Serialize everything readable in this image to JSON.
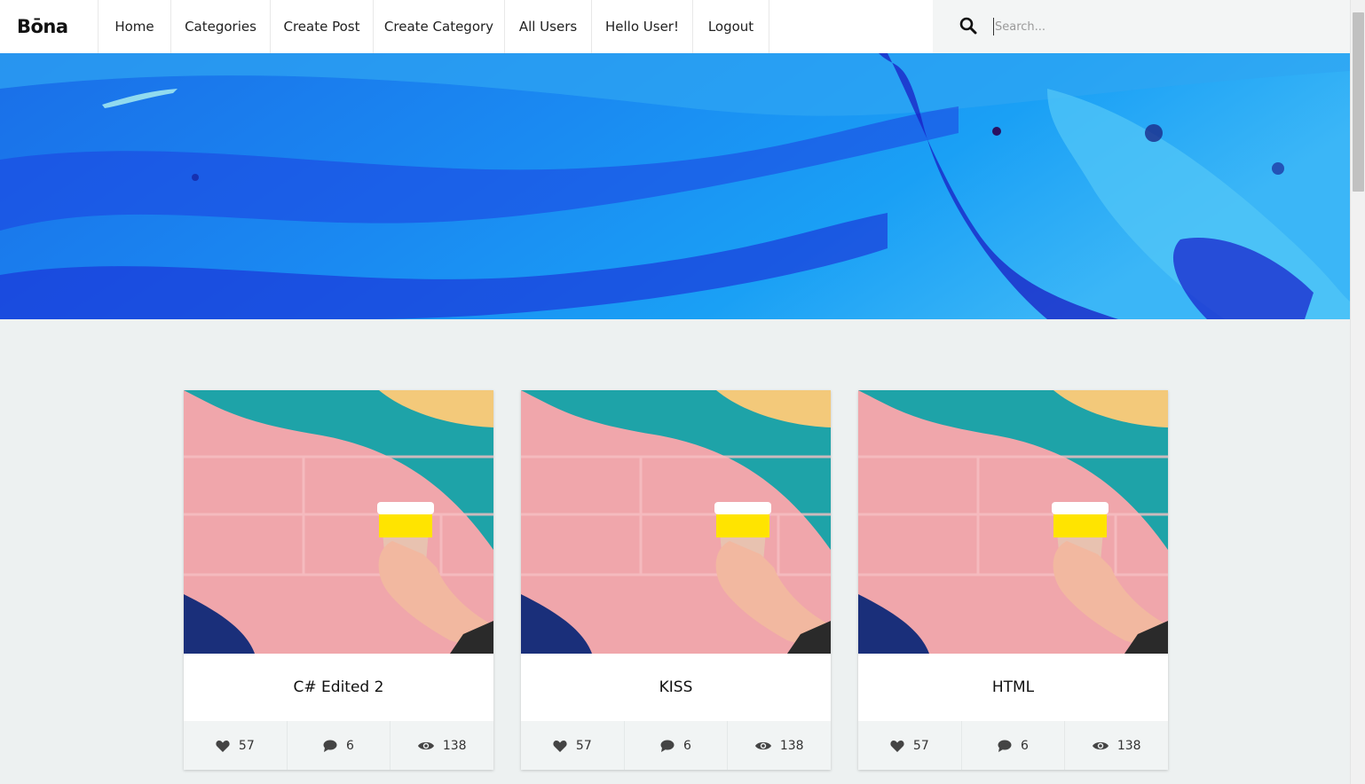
{
  "header": {
    "logo": "Bōna",
    "nav": [
      "Home",
      "Categories",
      "Create Post",
      "Create Category",
      "All Users",
      "Hello User!",
      "Logout"
    ],
    "search_placeholder": "Search..."
  },
  "posts": [
    {
      "title": "C# Edited 2",
      "likes": "57",
      "comments": "6",
      "views": "138"
    },
    {
      "title": "KISS",
      "likes": "57",
      "comments": "6",
      "views": "138"
    },
    {
      "title": "HTML",
      "likes": "57",
      "comments": "6",
      "views": "138"
    }
  ],
  "colors": {
    "page_bg": "#edf1f1",
    "hero_blue": "#1a7ff0",
    "hero_dark_blue": "#1b1fc8",
    "wall_pink": "#f0a6ab",
    "wall_teal": "#1ea3a8",
    "wall_yellow": "#f3c97a",
    "cup_yellow": "#ffe400"
  },
  "icons": [
    "search-icon",
    "heart-icon",
    "comment-icon",
    "eye-icon"
  ]
}
